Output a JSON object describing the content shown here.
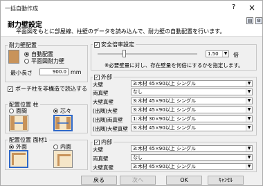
{
  "window": {
    "title": "一括自動作成",
    "help_icon": "?",
    "close_icon": "×"
  },
  "header": {
    "title": "耐力壁設定",
    "description": "平面図をもとに部屋線、柱壁のデータを読み込んで、耐力壁の自動配置を行います。"
  },
  "wall_placement": {
    "legend": "耐力壁配置",
    "option_auto": "自動配置",
    "option_floorplan": "平面図耐力壁",
    "min_length_label": "最小長さ",
    "min_length_value": "900.0",
    "min_length_unit": "mm"
  },
  "porch_checkbox": "ポーチ柱を非構造で読込する",
  "column_position": {
    "legend": "配置位置 柱",
    "option_face": "面間",
    "option_core": "芯々"
  },
  "face_position": {
    "legend": "配置位置 面材1",
    "option_outer": "外面",
    "option_inner": "内面"
  },
  "safety": {
    "label": "安全倍率設定",
    "value": "1.50",
    "unit": "倍",
    "note": "※必要壁量に対し、存在壁量を何倍にするかを指定します。"
  },
  "exterior": {
    "legend": "外部",
    "rows": [
      {
        "label": "大壁",
        "value": "3:木材 45×90以上 シングル"
      },
      {
        "label": "両真壁",
        "value": "なし"
      },
      {
        "label": "大壁真壁",
        "value": "3:木材 45×90以上 シングル"
      },
      {
        "label": "(出隅)大壁",
        "value": "3:木材 45×90以上 シングル"
      },
      {
        "label": "(出隅)両真壁",
        "value": "1:木材 30×90以上 シングル"
      },
      {
        "label": "(出隅)大壁真壁",
        "value": "3:木材 45×90以上 シングル"
      }
    ]
  },
  "interior": {
    "legend": "内部",
    "rows": [
      {
        "label": "大壁",
        "value": "3:木材 45×90以上 シングル"
      },
      {
        "label": "両真壁",
        "value": "なし"
      },
      {
        "label": "大壁真壁",
        "value": "3:木材 45×90以上 シングル"
      }
    ]
  },
  "footer": {
    "back": "戻る",
    "next": "次へ",
    "ok": "OK",
    "cancel": "ｷｬﾝｾﾙ"
  }
}
